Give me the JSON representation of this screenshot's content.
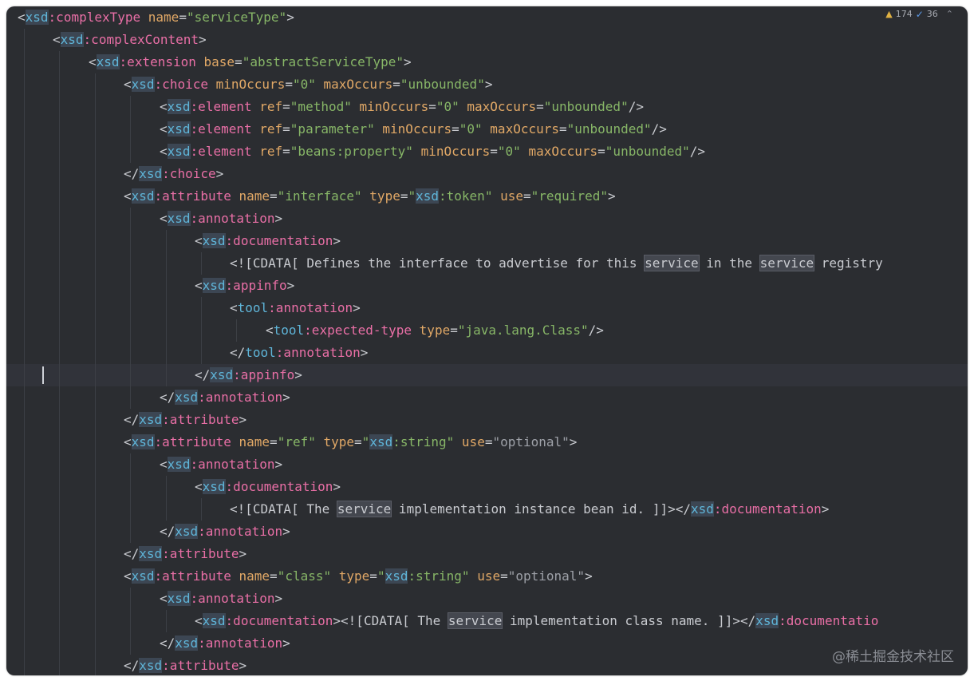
{
  "inspection": {
    "warnings": "174",
    "checks": "36"
  },
  "watermark": "@稀土掘金技术社区",
  "lines": [
    {
      "indent": 0,
      "tokens": [
        [
          "p",
          "<"
        ],
        [
          "ns",
          "xsd"
        ],
        [
          "tag",
          ":complexType"
        ],
        [
          "p",
          " "
        ],
        [
          "attr",
          "name"
        ],
        [
          "p",
          "="
        ],
        [
          "val",
          "\"serviceType\""
        ],
        [
          "p",
          ">"
        ]
      ]
    },
    {
      "indent": 1,
      "tokens": [
        [
          "p",
          "<"
        ],
        [
          "ns",
          "xsd"
        ],
        [
          "tag",
          ":complexContent"
        ],
        [
          "p",
          ">"
        ]
      ]
    },
    {
      "indent": 2,
      "tokens": [
        [
          "p",
          "<"
        ],
        [
          "ns",
          "xsd"
        ],
        [
          "tag",
          ":extension"
        ],
        [
          "p",
          " "
        ],
        [
          "attr",
          "base"
        ],
        [
          "p",
          "="
        ],
        [
          "val",
          "\"abstractServiceType\""
        ],
        [
          "p",
          ">"
        ]
      ]
    },
    {
      "indent": 3,
      "tokens": [
        [
          "p",
          "<"
        ],
        [
          "ns",
          "xsd"
        ],
        [
          "tag",
          ":choice"
        ],
        [
          "p",
          " "
        ],
        [
          "attr",
          "minOccurs"
        ],
        [
          "p",
          "="
        ],
        [
          "val",
          "\"0\""
        ],
        [
          "p",
          " "
        ],
        [
          "attr",
          "maxOccurs"
        ],
        [
          "p",
          "="
        ],
        [
          "val",
          "\"unbounded\""
        ],
        [
          "p",
          ">"
        ]
      ]
    },
    {
      "indent": 4,
      "tokens": [
        [
          "p",
          "<"
        ],
        [
          "ns",
          "xsd"
        ],
        [
          "tag",
          ":element"
        ],
        [
          "p",
          " "
        ],
        [
          "attr",
          "ref"
        ],
        [
          "p",
          "="
        ],
        [
          "val",
          "\"method\""
        ],
        [
          "p",
          " "
        ],
        [
          "attr",
          "minOccurs"
        ],
        [
          "p",
          "="
        ],
        [
          "val",
          "\"0\""
        ],
        [
          "p",
          " "
        ],
        [
          "attr",
          "maxOccurs"
        ],
        [
          "p",
          "="
        ],
        [
          "val",
          "\"unbounded\""
        ],
        [
          "p",
          "/>"
        ]
      ]
    },
    {
      "indent": 4,
      "tokens": [
        [
          "p",
          "<"
        ],
        [
          "ns",
          "xsd"
        ],
        [
          "tag",
          ":element"
        ],
        [
          "p",
          " "
        ],
        [
          "attr",
          "ref"
        ],
        [
          "p",
          "="
        ],
        [
          "val",
          "\"parameter\""
        ],
        [
          "p",
          " "
        ],
        [
          "attr",
          "minOccurs"
        ],
        [
          "p",
          "="
        ],
        [
          "val",
          "\"0\""
        ],
        [
          "p",
          " "
        ],
        [
          "attr",
          "maxOccurs"
        ],
        [
          "p",
          "="
        ],
        [
          "val",
          "\"unbounded\""
        ],
        [
          "p",
          "/>"
        ]
      ]
    },
    {
      "indent": 4,
      "tokens": [
        [
          "p",
          "<"
        ],
        [
          "ns",
          "xsd"
        ],
        [
          "tag",
          ":element"
        ],
        [
          "p",
          " "
        ],
        [
          "attr",
          "ref"
        ],
        [
          "p",
          "="
        ],
        [
          "val",
          "\"beans:property\""
        ],
        [
          "p",
          " "
        ],
        [
          "attr",
          "minOccurs"
        ],
        [
          "p",
          "="
        ],
        [
          "val",
          "\"0\""
        ],
        [
          "p",
          " "
        ],
        [
          "attr",
          "maxOccurs"
        ],
        [
          "p",
          "="
        ],
        [
          "val",
          "\"unbounded\""
        ],
        [
          "p",
          "/>"
        ]
      ]
    },
    {
      "indent": 3,
      "tokens": [
        [
          "p",
          "</"
        ],
        [
          "ns",
          "xsd"
        ],
        [
          "tag",
          ":choice"
        ],
        [
          "p",
          ">"
        ]
      ]
    },
    {
      "indent": 3,
      "tokens": [
        [
          "p",
          "<"
        ],
        [
          "ns",
          "xsd"
        ],
        [
          "tag",
          ":attribute"
        ],
        [
          "p",
          " "
        ],
        [
          "attr",
          "name"
        ],
        [
          "p",
          "="
        ],
        [
          "val",
          "\"interface\""
        ],
        [
          "p",
          " "
        ],
        [
          "attr",
          "type"
        ],
        [
          "p",
          "="
        ],
        [
          "val",
          "\""
        ],
        [
          "ns",
          "xsd"
        ],
        [
          "val",
          ":token\""
        ],
        [
          "p",
          " "
        ],
        [
          "attr",
          "use"
        ],
        [
          "p",
          "="
        ],
        [
          "val",
          "\"required\""
        ],
        [
          "p",
          ">"
        ]
      ]
    },
    {
      "indent": 4,
      "tokens": [
        [
          "p",
          "<"
        ],
        [
          "ns",
          "xsd"
        ],
        [
          "tag",
          ":annotation"
        ],
        [
          "p",
          ">"
        ]
      ]
    },
    {
      "indent": 5,
      "tokens": [
        [
          "p",
          "<"
        ],
        [
          "ns",
          "xsd"
        ],
        [
          "tag",
          ":documentation"
        ],
        [
          "p",
          ">"
        ]
      ]
    },
    {
      "indent": 6,
      "tokens": [
        [
          "text",
          "<![CDATA[ Defines the interface to advertise for this "
        ],
        [
          "hl",
          "service"
        ],
        [
          "text",
          " in the "
        ],
        [
          "hl",
          "service"
        ],
        [
          "text",
          " registry"
        ]
      ]
    },
    {
      "indent": 5,
      "tokens": [
        [
          "p",
          "<"
        ],
        [
          "ns",
          "xsd"
        ],
        [
          "tag",
          ":appinfo"
        ],
        [
          "p",
          ">"
        ]
      ]
    },
    {
      "indent": 6,
      "tokens": [
        [
          "p",
          "<"
        ],
        [
          "tool",
          "tool"
        ],
        [
          "tag",
          ":annotation"
        ],
        [
          "p",
          ">"
        ]
      ]
    },
    {
      "indent": 7,
      "tokens": [
        [
          "p",
          "<"
        ],
        [
          "tool",
          "tool"
        ],
        [
          "tag",
          ":expected-type"
        ],
        [
          "p",
          " "
        ],
        [
          "attr",
          "type"
        ],
        [
          "p",
          "="
        ],
        [
          "val",
          "\"java.lang.Class\""
        ],
        [
          "p",
          "/>"
        ]
      ]
    },
    {
      "indent": 6,
      "tokens": [
        [
          "p",
          "</"
        ],
        [
          "tool",
          "tool"
        ],
        [
          "tag",
          ":annotation"
        ],
        [
          "p",
          ">"
        ]
      ]
    },
    {
      "indent": 5,
      "current": true,
      "tokens": [
        [
          "p",
          "</"
        ],
        [
          "ns",
          "xsd"
        ],
        [
          "tag",
          ":appinfo"
        ],
        [
          "p",
          ">"
        ]
      ]
    },
    {
      "indent": 4,
      "tokens": [
        [
          "p",
          "</"
        ],
        [
          "ns",
          "xsd"
        ],
        [
          "tag",
          ":annotation"
        ],
        [
          "p",
          ">"
        ]
      ]
    },
    {
      "indent": 3,
      "tokens": [
        [
          "p",
          "</"
        ],
        [
          "ns",
          "xsd"
        ],
        [
          "tag",
          ":attribute"
        ],
        [
          "p",
          ">"
        ]
      ]
    },
    {
      "indent": 3,
      "tokens": [
        [
          "p",
          "<"
        ],
        [
          "ns",
          "xsd"
        ],
        [
          "tag",
          ":attribute"
        ],
        [
          "p",
          " "
        ],
        [
          "attr",
          "name"
        ],
        [
          "p",
          "="
        ],
        [
          "val",
          "\"ref\""
        ],
        [
          "p",
          " "
        ],
        [
          "attr",
          "type"
        ],
        [
          "p",
          "="
        ],
        [
          "val",
          "\""
        ],
        [
          "ns",
          "xsd"
        ],
        [
          "val",
          ":string\""
        ],
        [
          "p",
          " "
        ],
        [
          "attr",
          "use"
        ],
        [
          "p",
          "="
        ],
        [
          "valgray",
          "\"optional\""
        ],
        [
          "p",
          ">"
        ]
      ]
    },
    {
      "indent": 4,
      "tokens": [
        [
          "p",
          "<"
        ],
        [
          "ns",
          "xsd"
        ],
        [
          "tag",
          ":annotation"
        ],
        [
          "p",
          ">"
        ]
      ]
    },
    {
      "indent": 5,
      "tokens": [
        [
          "p",
          "<"
        ],
        [
          "ns",
          "xsd"
        ],
        [
          "tag",
          ":documentation"
        ],
        [
          "p",
          ">"
        ]
      ]
    },
    {
      "indent": 6,
      "tokens": [
        [
          "text",
          "<![CDATA[ The "
        ],
        [
          "hl",
          "service"
        ],
        [
          "text",
          " implementation instance bean id. ]]>"
        ],
        [
          "p",
          "</"
        ],
        [
          "ns",
          "xsd"
        ],
        [
          "tag",
          ":documentation"
        ],
        [
          "p",
          ">"
        ]
      ]
    },
    {
      "indent": 4,
      "tokens": [
        [
          "p",
          "</"
        ],
        [
          "ns",
          "xsd"
        ],
        [
          "tag",
          ":annotation"
        ],
        [
          "p",
          ">"
        ]
      ]
    },
    {
      "indent": 3,
      "tokens": [
        [
          "p",
          "</"
        ],
        [
          "ns",
          "xsd"
        ],
        [
          "tag",
          ":attribute"
        ],
        [
          "p",
          ">"
        ]
      ]
    },
    {
      "indent": 3,
      "tokens": [
        [
          "p",
          "<"
        ],
        [
          "ns",
          "xsd"
        ],
        [
          "tag",
          ":attribute"
        ],
        [
          "p",
          " "
        ],
        [
          "attr",
          "name"
        ],
        [
          "p",
          "="
        ],
        [
          "val",
          "\"class\""
        ],
        [
          "p",
          " "
        ],
        [
          "attr",
          "type"
        ],
        [
          "p",
          "="
        ],
        [
          "val",
          "\""
        ],
        [
          "ns",
          "xsd"
        ],
        [
          "val",
          ":string\""
        ],
        [
          "p",
          " "
        ],
        [
          "attr",
          "use"
        ],
        [
          "p",
          "="
        ],
        [
          "valgray",
          "\"optional\""
        ],
        [
          "p",
          ">"
        ]
      ]
    },
    {
      "indent": 4,
      "tokens": [
        [
          "p",
          "<"
        ],
        [
          "ns",
          "xsd"
        ],
        [
          "tag",
          ":annotation"
        ],
        [
          "p",
          ">"
        ]
      ]
    },
    {
      "indent": 5,
      "tokens": [
        [
          "p",
          "<"
        ],
        [
          "ns",
          "xsd"
        ],
        [
          "tag",
          ":documentation"
        ],
        [
          "p",
          "><![CDATA[ The "
        ],
        [
          "hl",
          "service"
        ],
        [
          "text",
          " implementation class name. ]]>"
        ],
        [
          "p",
          "</"
        ],
        [
          "ns",
          "xsd"
        ],
        [
          "tag",
          ":documentatio"
        ]
      ]
    },
    {
      "indent": 4,
      "tokens": [
        [
          "p",
          "</"
        ],
        [
          "ns",
          "xsd"
        ],
        [
          "tag",
          ":annotation"
        ],
        [
          "p",
          ">"
        ]
      ]
    },
    {
      "indent": 3,
      "tokens": [
        [
          "p",
          "</"
        ],
        [
          "ns",
          "xsd"
        ],
        [
          "tag",
          ":attribute"
        ],
        [
          "p",
          ">"
        ]
      ]
    }
  ]
}
